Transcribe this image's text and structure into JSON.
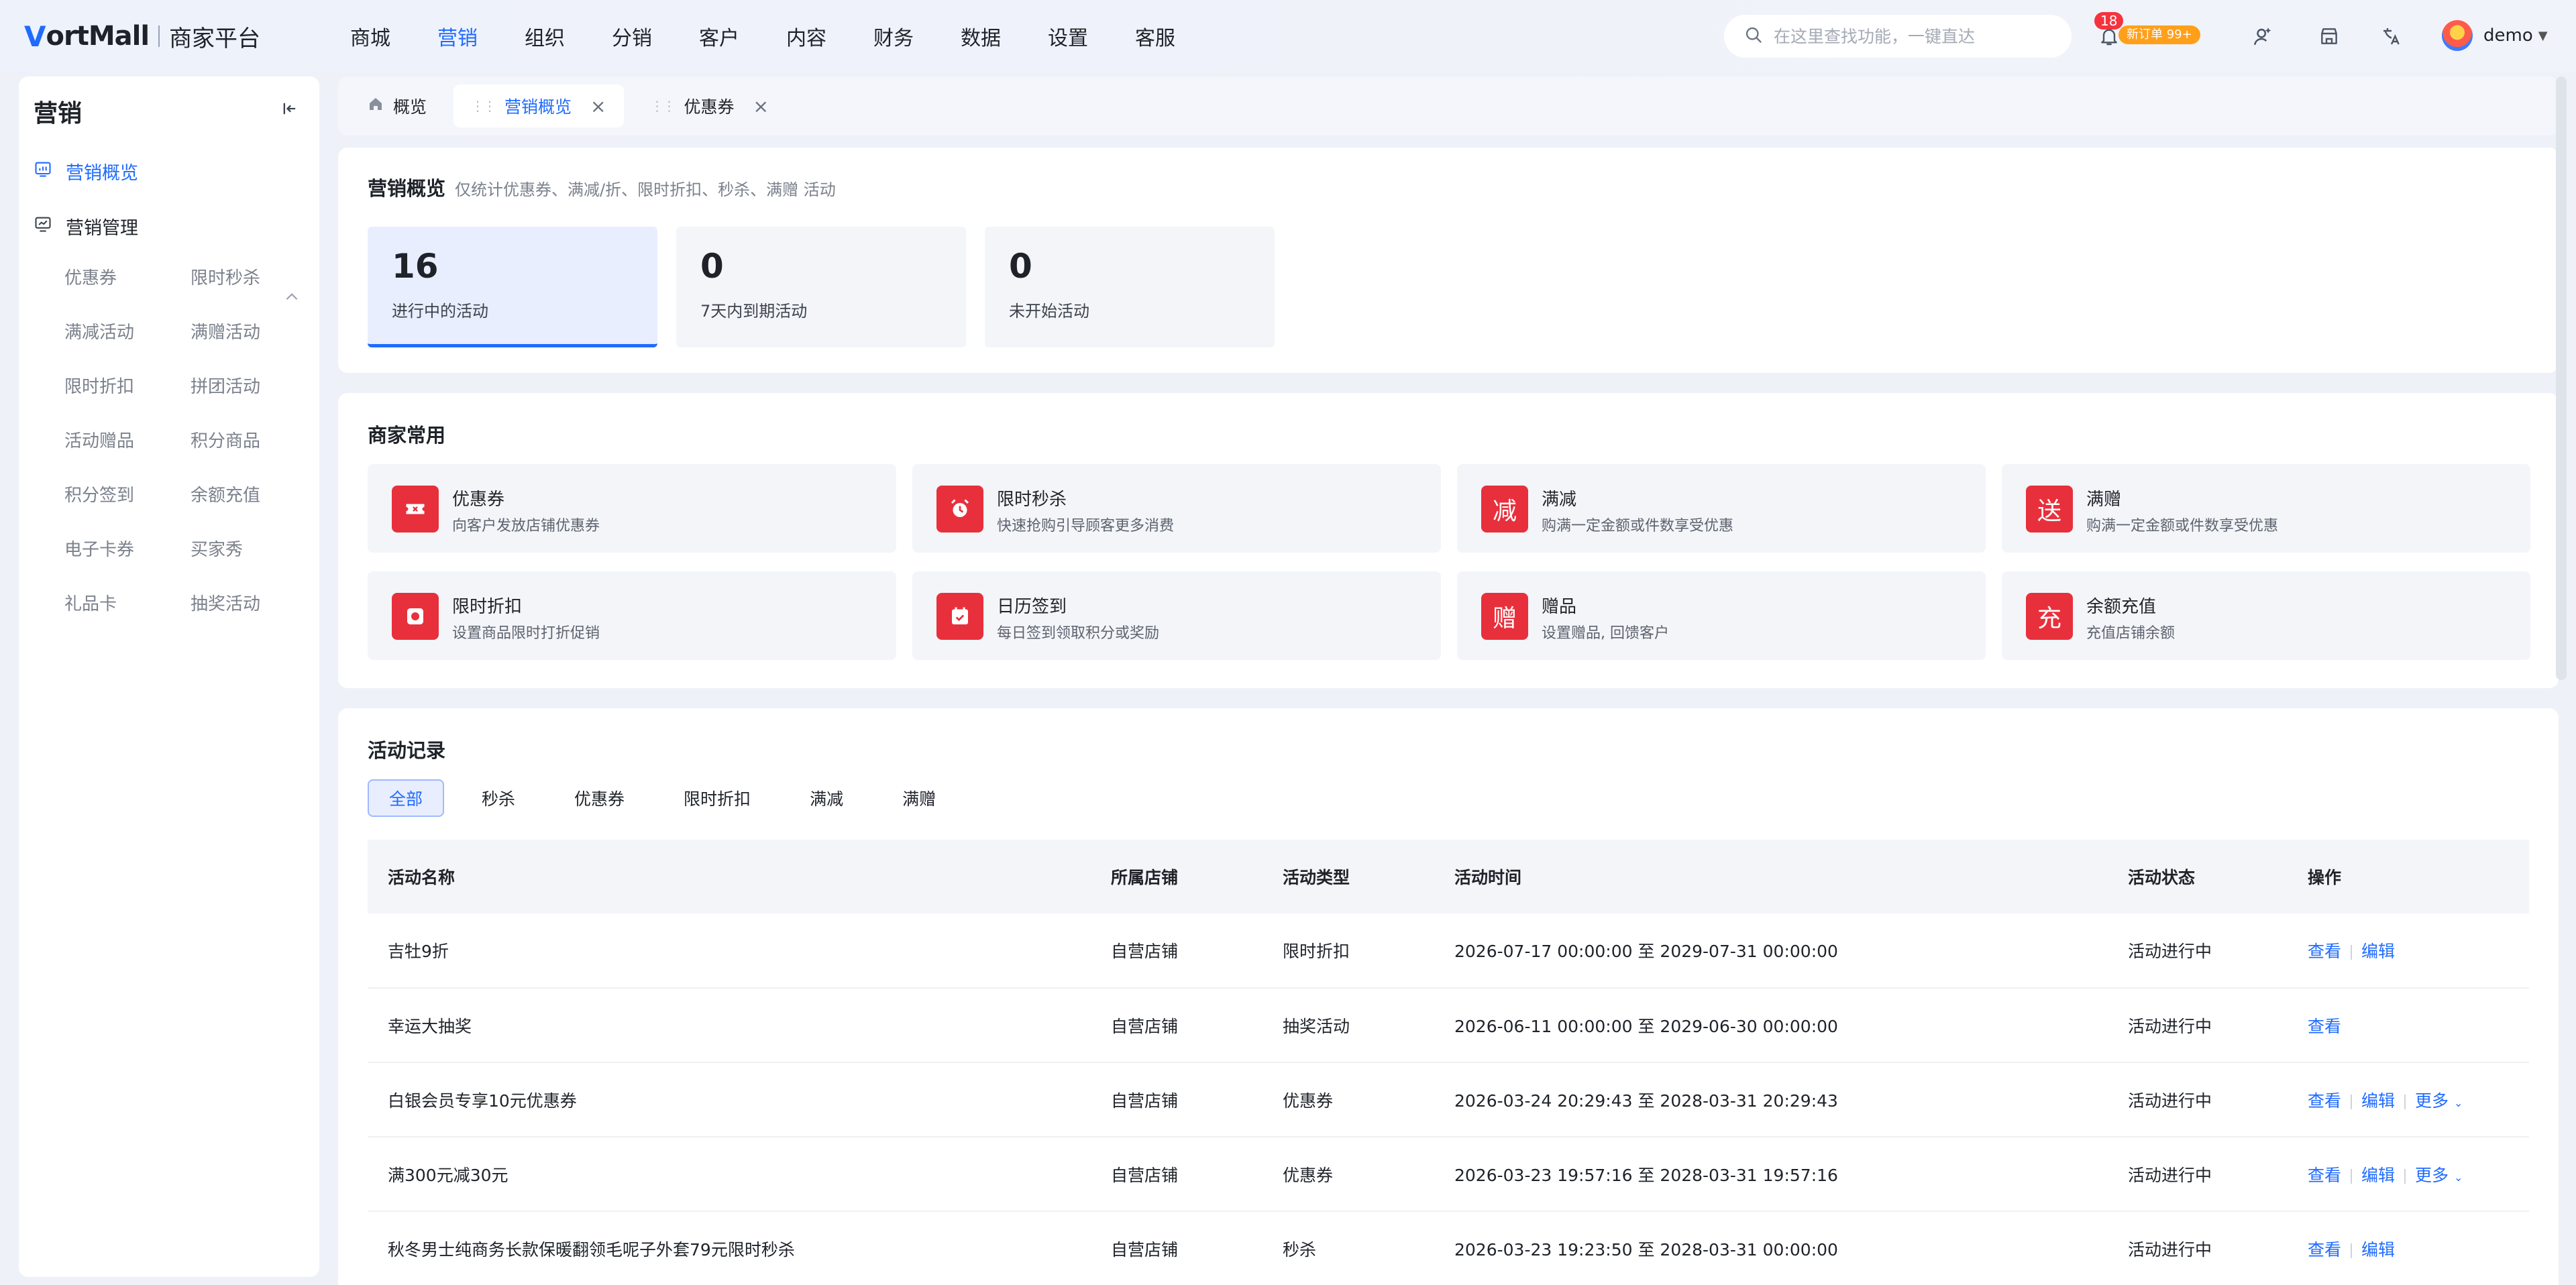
{
  "header": {
    "logo_mark": "V",
    "logo_brand": "ortMall",
    "logo_sub": "商家平台",
    "nav": [
      "商城",
      "营销",
      "组织",
      "分销",
      "客户",
      "内容",
      "财务",
      "数据",
      "设置",
      "客服"
    ],
    "active_nav": "营销",
    "search_placeholder": "在这里查找功能，一键直达",
    "notification_count": "18",
    "order_badge": "新订单 99+",
    "user_name": "demo",
    "accent": "#1f6bff"
  },
  "sidebar": {
    "title": "营销",
    "items": [
      {
        "label": "营销概览",
        "active": true
      },
      {
        "label": "营销管理",
        "active": false
      }
    ],
    "sub_items": [
      [
        "优惠券",
        "限时秒杀"
      ],
      [
        "满减活动",
        "满赠活动"
      ],
      [
        "限时折扣",
        "拼团活动"
      ],
      [
        "活动赠品",
        "积分商品"
      ],
      [
        "积分签到",
        "余额充值"
      ],
      [
        "电子卡券",
        "买家秀"
      ],
      [
        "礼品卡",
        "抽奖活动"
      ]
    ]
  },
  "tabs": [
    {
      "label": "概览",
      "closable": false
    },
    {
      "label": "营销概览",
      "closable": true,
      "active": true
    },
    {
      "label": "优惠券",
      "closable": true
    }
  ],
  "overview": {
    "title": "营销概览",
    "subtitle": "仅统计优惠券、满减/折、限时折扣、秒杀、满赠 活动",
    "stats": [
      {
        "value": "16",
        "label": "进行中的活动"
      },
      {
        "value": "0",
        "label": "7天内到期活动"
      },
      {
        "value": "0",
        "label": "未开始活动"
      }
    ]
  },
  "tools": {
    "title": "商家常用",
    "items": [
      {
        "name": "优惠券",
        "desc": "向客户发放店铺优惠券",
        "icon": "ticket-icon"
      },
      {
        "name": "限时秒杀",
        "desc": "快速抢购引导顾客更多消费",
        "icon": "alarm-icon"
      },
      {
        "name": "满减",
        "desc": "购满一定金额或件数享受优惠",
        "icon": "减"
      },
      {
        "name": "满赠",
        "desc": "购满一定金额或件数享受优惠",
        "icon": "送"
      },
      {
        "name": "限时折扣",
        "desc": "设置商品限时打折促销",
        "icon": "discount-icon"
      },
      {
        "name": "日历签到",
        "desc": "每日签到领取积分或奖励",
        "icon": "calendar-icon"
      },
      {
        "name": "赠品",
        "desc": "设置赠品, 回馈客户",
        "icon": "赠"
      },
      {
        "name": "余额充值",
        "desc": "充值店铺余额",
        "icon": "充"
      }
    ]
  },
  "records": {
    "title": "活动记录",
    "filters": [
      "全部",
      "秒杀",
      "优惠券",
      "限时折扣",
      "满减",
      "满赠"
    ],
    "columns": [
      "活动名称",
      "所属店铺",
      "活动类型",
      "活动时间",
      "活动状态",
      "操作"
    ],
    "rows": [
      {
        "name": "吉牡9折",
        "store": "自营店铺",
        "type": "限时折扣",
        "time": "2026-07-17 00:00:00 至 2029-07-31 00:00:00",
        "status": "活动进行中",
        "ops": [
          "查看",
          "编辑"
        ]
      },
      {
        "name": "幸运大抽奖",
        "store": "自营店铺",
        "type": "抽奖活动",
        "time": "2026-06-11 00:00:00 至 2029-06-30 00:00:00",
        "status": "活动进行中",
        "ops": [
          "查看"
        ]
      },
      {
        "name": "白银会员专享10元优惠券",
        "store": "自营店铺",
        "type": "优惠券",
        "time": "2026-03-24 20:29:43 至 2028-03-31 20:29:43",
        "status": "活动进行中",
        "ops": [
          "查看",
          "编辑",
          "更多"
        ]
      },
      {
        "name": "满300元减30元",
        "store": "自营店铺",
        "type": "优惠券",
        "time": "2026-03-23 19:57:16 至 2028-03-31 19:57:16",
        "status": "活动进行中",
        "ops": [
          "查看",
          "编辑",
          "更多"
        ]
      },
      {
        "name": "秋冬男士纯商务长款保暖翻领毛呢子外套79元限时秒杀",
        "store": "自营店铺",
        "type": "秒杀",
        "time": "2026-03-23 19:23:50 至 2028-03-31 00:00:00",
        "status": "活动进行中",
        "ops": [
          "查看",
          "编辑"
        ]
      }
    ]
  }
}
